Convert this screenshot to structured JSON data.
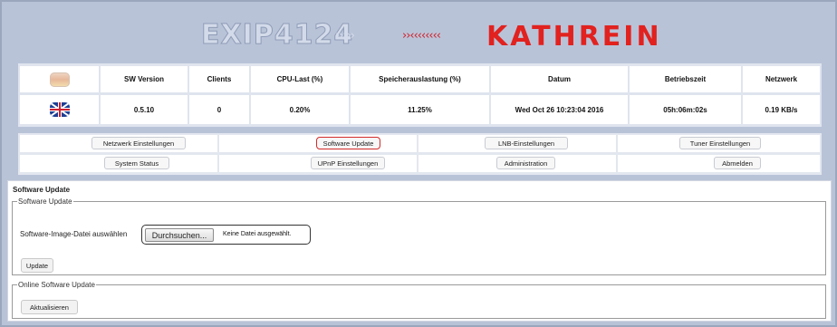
{
  "brand": {
    "product": "EXIP4124",
    "chevrons_light": "›››››",
    "chevrons_red": "››‹‹‹‹‹‹‹‹",
    "company": "KATHREIN",
    "red": "#e1221f"
  },
  "status_table": {
    "headers": [
      "SW Version",
      "Clients",
      "CPU-Last (%)",
      "Speicherauslastung (%)",
      "Datum",
      "Betriebszeit",
      "Netzwerk"
    ],
    "values": [
      "0.5.10",
      "0",
      "0.20%",
      "11.25%",
      "Wed Oct 26 10:23:04 2016",
      "05h:06m:02s",
      "0.19 KB/s"
    ],
    "languages": [
      "german-flag-icon",
      "uk-flag-icon"
    ]
  },
  "nav": {
    "row1": [
      "Netzwerk Einstellungen",
      "Software Update",
      "LNB-Einstellungen",
      "Tuner Einstellungen"
    ],
    "row2": [
      "System Status",
      "UPnP Einstellungen",
      "Administration",
      "Abmelden"
    ],
    "active": "Software Update"
  },
  "content": {
    "title": "Software Update",
    "software_update": {
      "legend": "Software Update",
      "file_label": "Software-Image-Datei auswählen",
      "browse_label": "Durchsuchen...",
      "no_file": "Keine Datei ausgewählt.",
      "update_label": "Update"
    },
    "online_update": {
      "legend": "Online Software Update",
      "refresh_label": "Aktualisieren"
    }
  }
}
